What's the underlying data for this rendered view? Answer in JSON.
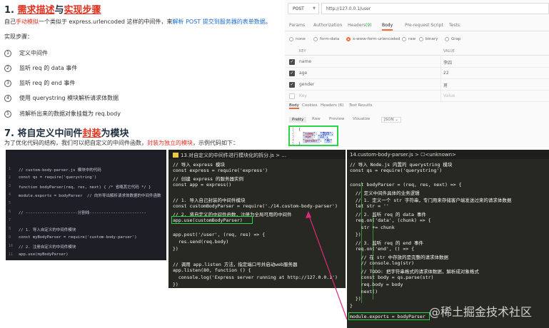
{
  "section1": {
    "number": "1.",
    "title_part1": "需求描述",
    "title_mid": "与",
    "title_part2": "实现步骤",
    "intro_prefix": "自己",
    "intro_red": "手动模拟",
    "intro_mid": "一个类似于 express.urlencoded 这样的中间件，来",
    "intro_blue": "解析 POST 提交到服务器的表单数据",
    "intro_suffix": "。",
    "steps_label": "实现步骤：",
    "steps": [
      {
        "num": "1",
        "text": "定义中间件"
      },
      {
        "num": "2",
        "text": "监听 req 的 data 事件"
      },
      {
        "num": "3",
        "text": "监听 req 的 end 事件"
      },
      {
        "num": "4",
        "text": "使用 querystring 模块解析请求体数据"
      },
      {
        "num": "5",
        "text": "将解析出来的数据对象挂载为 req.body"
      }
    ]
  },
  "section7": {
    "number": "7.",
    "title_part1": "将自定义中间件",
    "title_red": "封装",
    "title_part2": "为模块",
    "desc_prefix": "为了优化代码的结构，我们可以把自定义的中间件函数，",
    "desc_red": "封装为独立的模块",
    "desc_suffix": "，示例代码如下："
  },
  "panel1": {
    "lines": [
      {
        "n": "1",
        "text": "// custom-body-parser.js 模块中的代码"
      },
      {
        "n": "2",
        "text": "const qs = require('querystring')"
      },
      {
        "n": "3",
        "text": "function bodyParser(req, res, next) { /* 省略其它代码 */ }"
      },
      {
        "n": "4",
        "text": "module.exports = bodyParser  // 向外导出解析请求体数据的中间件函数"
      },
      {
        "n": "5",
        "text": ""
      },
      {
        "n": "6",
        "text": "// ----------------------分割线------------------------"
      },
      {
        "n": "7",
        "text": ""
      },
      {
        "n": "8",
        "text": "// 1. 导入自定义的中间件模块"
      },
      {
        "n": "9",
        "text": "const myBodyParser = require('custom-body-parser')"
      },
      {
        "n": "10",
        "text": "// 2. 注册自定义的中间件模块"
      },
      {
        "n": "11",
        "text": "app.use(myBodyParser)"
      }
    ]
  },
  "panel2": {
    "tab": "13.对自定义的中间件进行模块化的拆分.js > ...",
    "lines": [
      "// 导入 express 模块",
      "const express = require('express')",
      "// 创建 express 的服务器实例",
      "const app = express()",
      "",
      "// 1. 导入自己封装的中间件模块",
      "const customBodyParser = require('./14.custom-body-parser')",
      "// 2. 将自定义的中间件函数，注册为全局可用的中间件",
      "app.use(customBodyParser)",
      "",
      "app.post('/user', (req, res) => {",
      "  res.send(req.body)",
      "})",
      "",
      "// 调用 app.listen 方法，指定端口号并启动web服务器",
      "app.listen(80, function () {",
      "  console.log('Express server running at http://127.0.0.1')",
      "})"
    ]
  },
  "panel3": {
    "tab": "14.custom-body-parser.js > ☐<unknown>",
    "lines": [
      "// 导入 Node.js 内置的 querystring 模块",
      "const qs = require('querystring')",
      "",
      "const bodyParser = (req, res, next) => {",
      "  // 定义中间件具体的业务逻辑",
      "  // 1. 定义一个 str 字符串，专门用来存储客户端发送过来的请求体数据",
      "  let str = ''",
      "  // 2. 监听 req 的 data 事件",
      "  req.on('data', (chunk) => {",
      "    str += chunk",
      "  })",
      "  // 3. 监听 req 的 end 事件",
      "  req.on('end', () => {",
      "    // 在 str 中存放的是完整的请求体数据",
      "    // console.log(str)",
      "    // TODO: 把字符串格式的请求体数据，解析成对象格式",
      "    const body = qs.parse(str)",
      "    req.body = body",
      "    next()",
      "  })",
      "}",
      "",
      "module.exports = bodyParser"
    ]
  },
  "postman": {
    "method": "POST",
    "url": "http://127.0.0.1/user",
    "tabs": [
      "Params",
      "Authorization",
      "Headers",
      "(9)",
      "Body",
      "Pre-request Script",
      "Tests"
    ],
    "body_options": [
      "none",
      "form-data",
      "x-www-form-urlencoded",
      "raw",
      "binary",
      "Grap"
    ],
    "columns": [
      "KEY",
      "VALUE"
    ],
    "rows": [
      {
        "key": "name",
        "value": "李四",
        "checked": true
      },
      {
        "key": "age",
        "value": "22",
        "checked": true
      },
      {
        "key": "gender",
        "value": "男",
        "checked": true
      },
      {
        "key": "Key",
        "value": "Value",
        "checked": false
      }
    ],
    "response_tabs": [
      "Body",
      "Cookies",
      "Headers (6)",
      "Test Results"
    ],
    "view_tabs": [
      "Pretty",
      "Raw",
      "Preview",
      "Visualize",
      "JSON ⌄"
    ],
    "json_lines": [
      {
        "n": "1",
        "text": "{"
      },
      {
        "n": "2",
        "key": "\"name\"",
        "val": "\"李四\","
      },
      {
        "n": "3",
        "key": "\"age\"",
        "val": "\"22\","
      },
      {
        "n": "4",
        "key": "\"gender\"",
        "val": "\"男\""
      },
      {
        "n": "5",
        "text": "}"
      }
    ]
  },
  "watermark": "@稀土掘金技术社区"
}
